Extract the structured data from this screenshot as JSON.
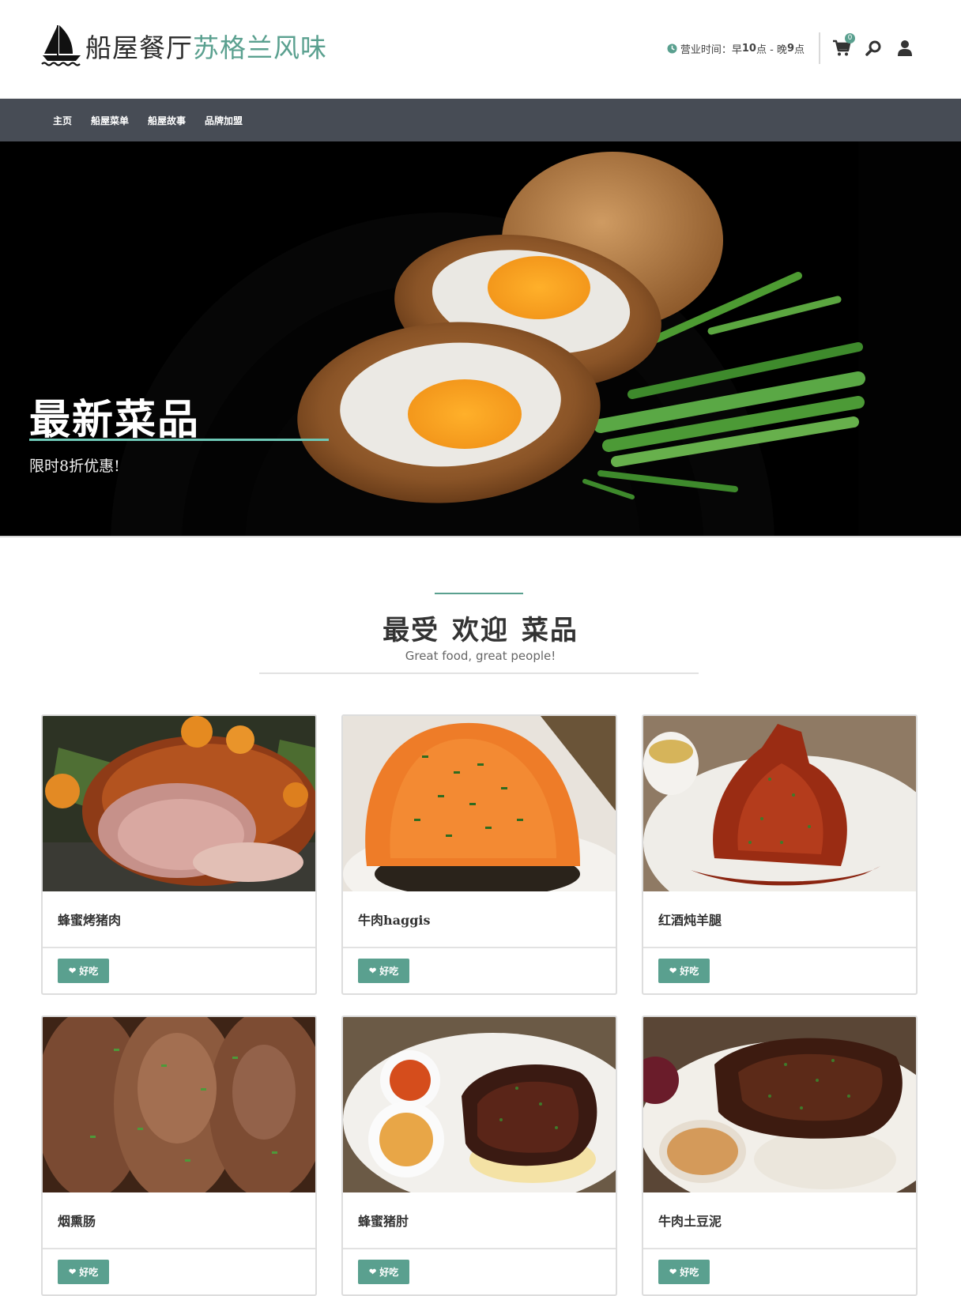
{
  "header": {
    "brand_main": "船屋餐厅",
    "brand_accent": "苏格兰风味",
    "hours_label": "营业时间：",
    "hours_open": "早",
    "hours_open_num": "10",
    "hours_mid": "点 - 晚",
    "hours_close_num": "9",
    "hours_end": "点",
    "cart_count": "0",
    "icons": [
      "sailboat-logo",
      "clock-icon",
      "cart-icon",
      "search-icon",
      "user-icon"
    ]
  },
  "nav": {
    "items": [
      "主页",
      "船屋菜单",
      "船屋故事",
      "品牌加盟"
    ]
  },
  "hero": {
    "title": "最新菜品",
    "subtitle": "限时8折优惠!"
  },
  "section": {
    "title": "最受 欢迎 菜品",
    "subtitle": "Great food, great people!"
  },
  "dishes": [
    {
      "name": "蜂蜜烤猪肉",
      "button": "好吃"
    },
    {
      "name": "牛肉haggis",
      "button": "好吃"
    },
    {
      "name": "红酒炖羊腿",
      "button": "好吃"
    },
    {
      "name": "烟熏肠",
      "button": "好吃"
    },
    {
      "name": "蜂蜜猪肘",
      "button": "好吃"
    },
    {
      "name": "牛肉土豆泥",
      "button": "好吃"
    }
  ],
  "colors": {
    "accent": "#5aa08f",
    "nav_bg": "#474c55",
    "hero_line": "#6ec8b6"
  }
}
